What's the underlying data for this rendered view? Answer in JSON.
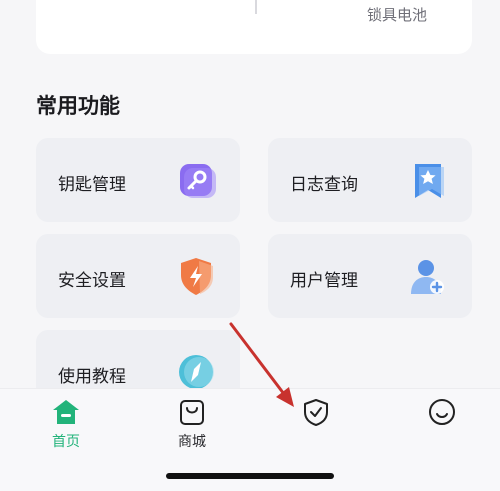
{
  "top_card": {
    "battery_label": "锁具电池"
  },
  "section": {
    "title": "常用功能"
  },
  "tiles": [
    {
      "label": "钥匙管理",
      "icon": "key-icon"
    },
    {
      "label": "日志查询",
      "icon": "bookmark-star-icon"
    },
    {
      "label": "安全设置",
      "icon": "shield-bolt-icon"
    },
    {
      "label": "用户管理",
      "icon": "user-add-icon"
    },
    {
      "label": "使用教程",
      "icon": "compass-icon"
    }
  ],
  "nav": [
    {
      "label": "首页",
      "icon": "home-icon",
      "active": true
    },
    {
      "label": "商城",
      "icon": "shopping-bag-icon",
      "active": false
    },
    {
      "label": "",
      "icon": "shield-check-icon",
      "active": false
    },
    {
      "label": "",
      "icon": "smile-icon",
      "active": false
    }
  ],
  "colors": {
    "accent_green": "#22b37a",
    "annotation_arrow": "#c8322e",
    "key_icon": "#8a6cf0",
    "log_icon": "#4a8fe8",
    "shield_icon": "#f07a45",
    "user_icon": "#5b93e6",
    "compass_icon": "#4dbfd8"
  }
}
